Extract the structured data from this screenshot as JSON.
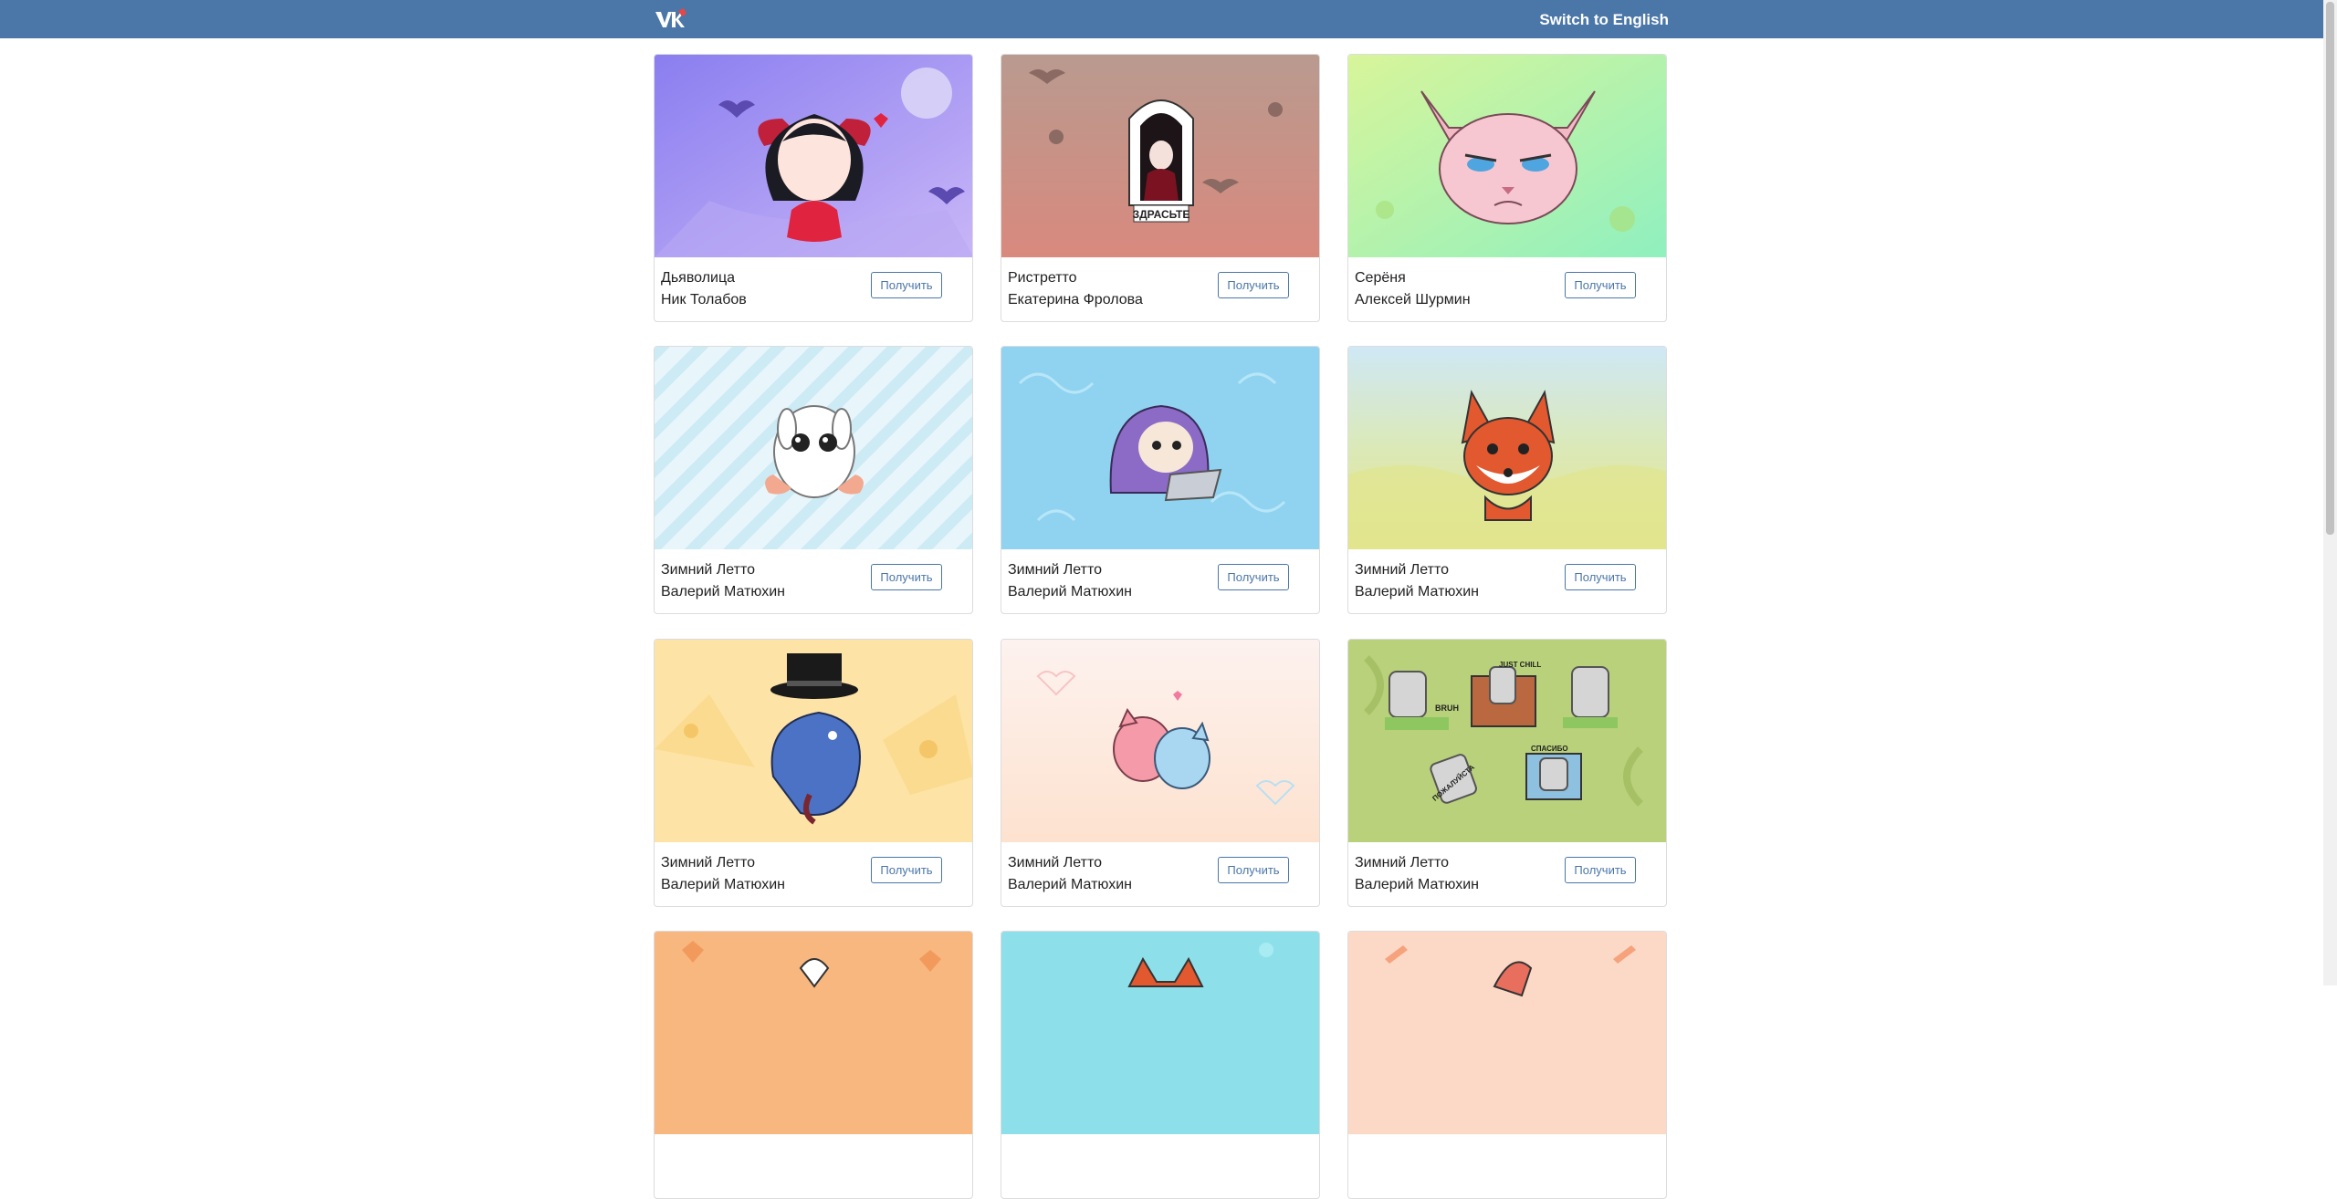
{
  "header": {
    "logo_icon": "vk-logo-icon",
    "switch_language_label": "Switch to English"
  },
  "colors": {
    "header_bg": "#4a76a8",
    "button_accent": "#4a76a8"
  },
  "packs": [
    {
      "title": "Дьяволица",
      "author": "Ник Толабов",
      "button": "Получить",
      "art": "devil-girl-sticker"
    },
    {
      "title": "Ристретто",
      "author": "Екатерина Фролова",
      "button": "Получить",
      "art": "vampire-door-sticker"
    },
    {
      "title": "Серёня",
      "author": "Алексей Шурмин",
      "button": "Получить",
      "art": "sphynx-cat-sticker"
    },
    {
      "title": "Зимний Летто",
      "author": "Валерий Матюхин",
      "button": "Получить",
      "art": "white-rabbit-sticker"
    },
    {
      "title": "Зимний Летто",
      "author": "Валерий Матюхин",
      "button": "Получить",
      "art": "hooded-cat-laptop-sticker"
    },
    {
      "title": "Зимний Летто",
      "author": "Валерий Матюхин",
      "button": "Получить",
      "art": "red-fox-sticker"
    },
    {
      "title": "Зимний Летто",
      "author": "Валерий Матюхин",
      "button": "Получить",
      "art": "top-hat-rat-sticker"
    },
    {
      "title": "Зимний Летто",
      "author": "Валерий Матюхин",
      "button": "Получить",
      "art": "cuddling-cats-sticker"
    },
    {
      "title": "Зимний Летто",
      "author": "Валерий Матюхин",
      "button": "Получить",
      "art": "moai-statues-sticker"
    }
  ],
  "sticker_texts": {
    "ristretto": "ЗДРАСЬТЕ",
    "moai_1": "BRUH",
    "moai_2": "JUST CHILL",
    "moai_3": "ПОЖАЛУЙСТА",
    "moai_4": "СПАСИБО"
  }
}
